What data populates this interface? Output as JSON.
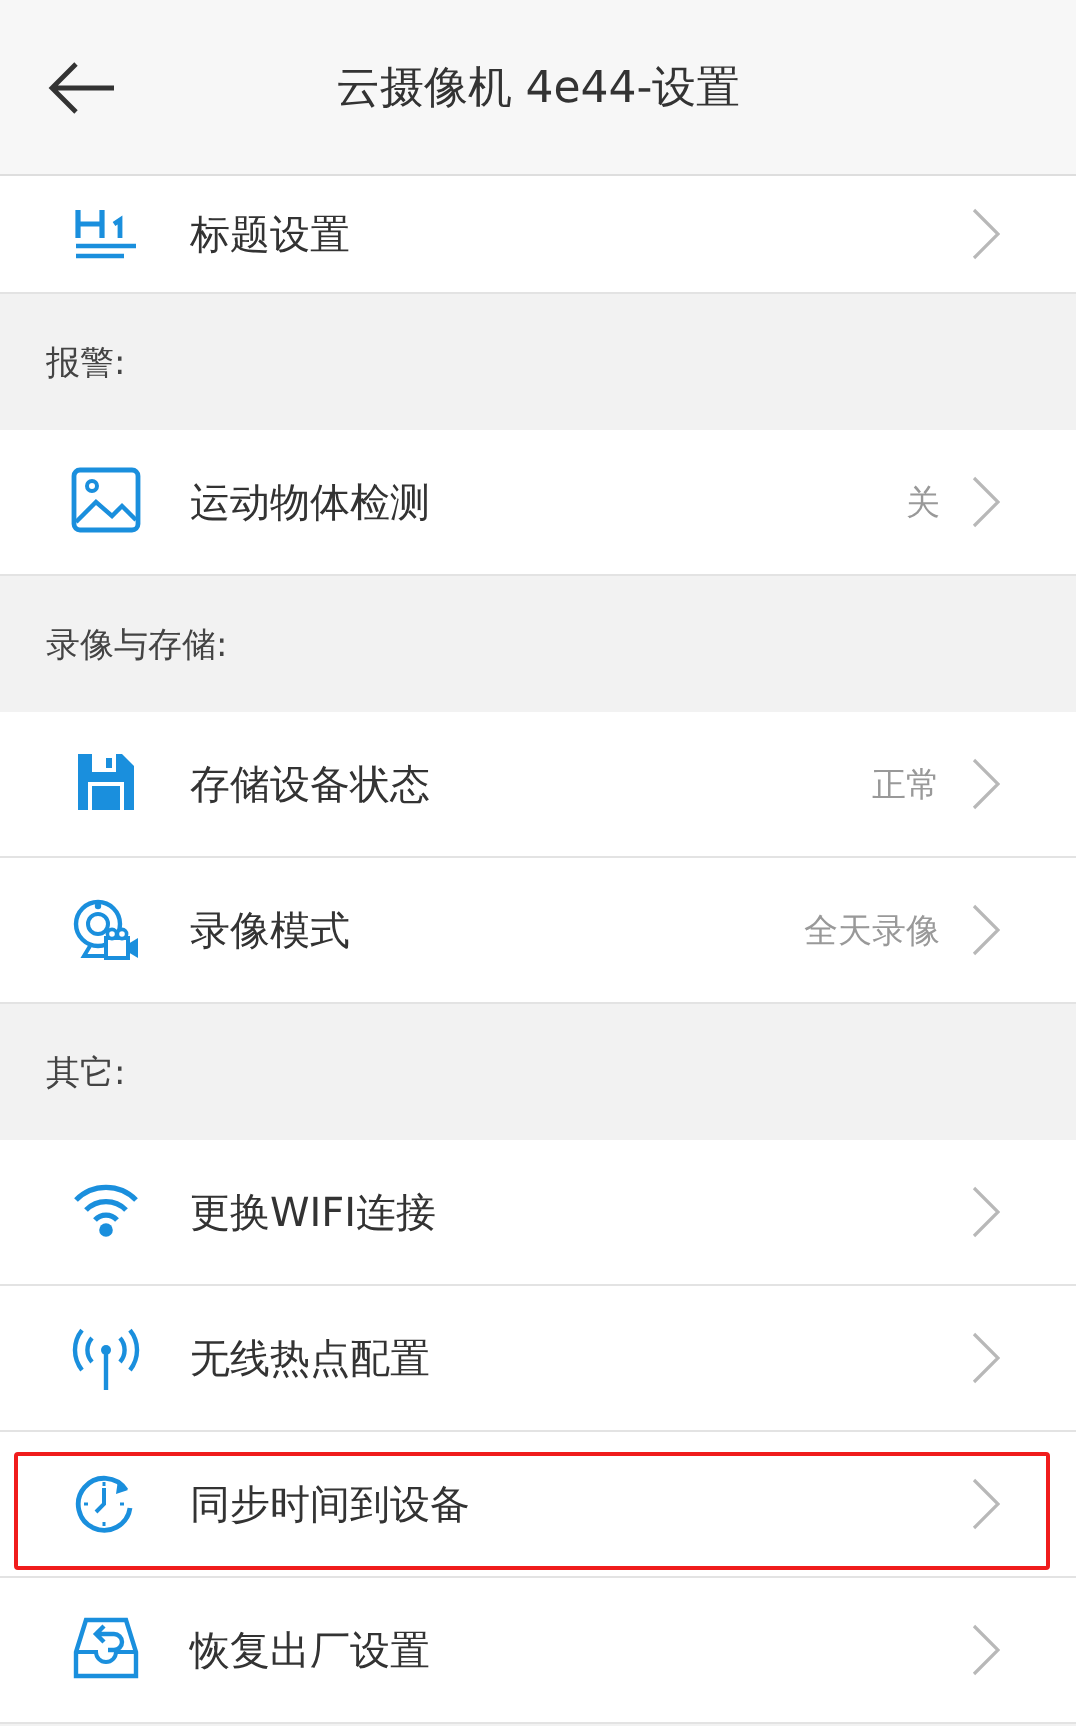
{
  "header": {
    "title": "云摄像机 4e44-设置"
  },
  "sections": [
    {
      "items": [
        {
          "label": "标题设置",
          "highlighted": false
        }
      ]
    },
    {
      "title": "报警:",
      "items": [
        {
          "label": "运动物体检测",
          "value": "关",
          "highlighted": false
        }
      ]
    },
    {
      "title": "录像与存储:",
      "items": [
        {
          "label": "存储设备状态",
          "value": "正常",
          "highlighted": false
        },
        {
          "label": "录像模式",
          "value": "全天录像",
          "highlighted": false
        }
      ]
    },
    {
      "title": "其它:",
      "items": [
        {
          "label": "更换WIFI连接",
          "highlighted": false
        },
        {
          "label": "无线热点配置",
          "highlighted": false
        },
        {
          "label": "同步时间到设备",
          "highlighted": true
        },
        {
          "label": "恢复出厂设置",
          "highlighted": false
        }
      ]
    }
  ]
}
